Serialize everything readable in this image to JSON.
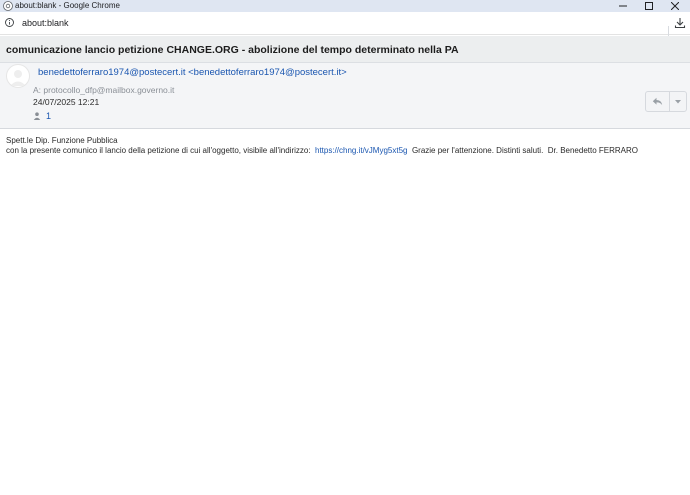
{
  "window": {
    "title": "about:blank - Google Chrome"
  },
  "addressbar": {
    "url": "about:blank"
  },
  "message": {
    "subject": "comunicazione lancio petizione CHANGE.ORG - abolizione del tempo determinato nella PA",
    "from": "benedettoferraro1974@postecert.it <benedettoferraro1974@postecert.it>",
    "to": "A: protocollo_dfp@mailbox.governo.it",
    "date": "24/07/2025 12:21",
    "recipient_count": "1",
    "body": {
      "greeting": "Spett.le Dip. Funzione Pubblica",
      "text_before_link": "con la presente comunico il lancio della petizione di cui all'oggetto, visibile all'indirizzo:  ",
      "link": "https://chng.it/vJMyg5xt5g",
      "text_after_link": "  Grazie per l'attenzione. Distinti saluti.  Dr. Benedetto FERRARO"
    }
  },
  "colors": {
    "link": "#1a56b0",
    "titlebar": "#dfe6f2",
    "header_bg": "#f4f5f7"
  }
}
